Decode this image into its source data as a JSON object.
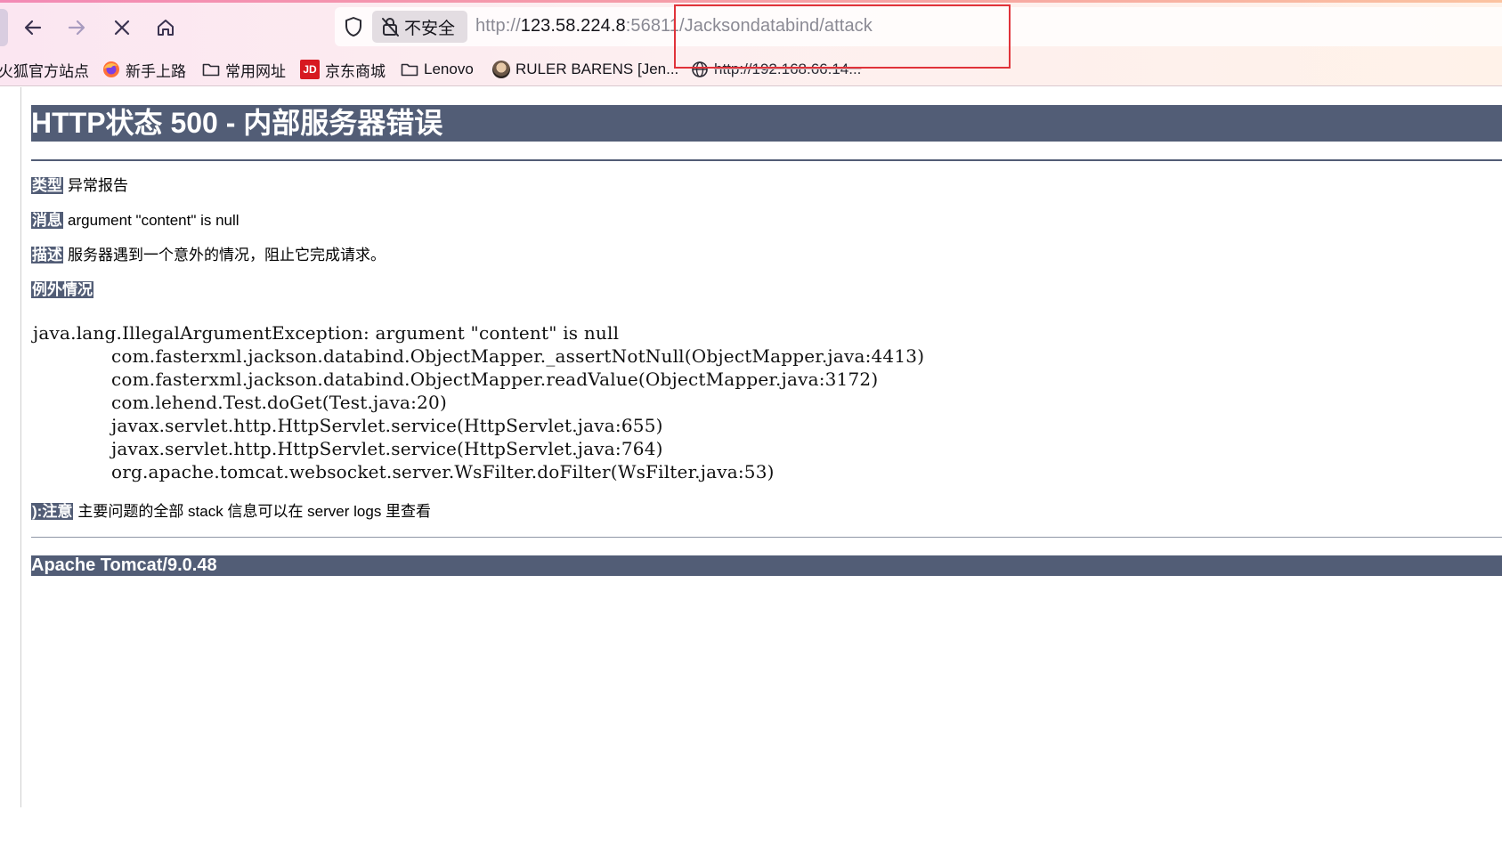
{
  "browser": {
    "nav": {
      "back_icon": "arrow-left-icon",
      "forward_icon": "arrow-right-icon",
      "stop_icon": "close-icon",
      "home_icon": "home-icon"
    },
    "urlbar": {
      "security_label": "不安全",
      "url_prefix": "http://",
      "url_host": "123.58.224.8",
      "url_rest": ":56811/Jacksondatabind/attack"
    },
    "bookmarks": [
      {
        "label": "火狐官方站点",
        "icon": "firefox-icon"
      },
      {
        "label": "新手上路",
        "icon": "firefox-icon"
      },
      {
        "label": "常用网址",
        "icon": "folder-icon"
      },
      {
        "label": "京东商城",
        "icon": "jd-logo-icon"
      },
      {
        "label": "Lenovo",
        "icon": "folder-icon"
      },
      {
        "label": "RULER BARENS [Jen...",
        "icon": "avatar-icon"
      },
      {
        "label": "http://192.168.66.14...",
        "icon": "globe-icon"
      }
    ],
    "accent_color": "#e0333a"
  },
  "page": {
    "title": "HTTP状态 500 - 内部服务器错误",
    "type_label": "类型",
    "type_value": "异常报告",
    "message_label": "消息",
    "message_value": "argument \"content\" is null",
    "description_label": "描述",
    "description_value": "服务器遇到一个意外的情况，阻止它完成请求。",
    "exception_label": "例外情况",
    "stack": {
      "exception": "java.lang.IllegalArgumentException: argument \"content\" is null",
      "frames": [
        "com.fasterxml.jackson.databind.ObjectMapper._assertNotNull(ObjectMapper.java:4413)",
        "com.fasterxml.jackson.databind.ObjectMapper.readValue(ObjectMapper.java:3172)",
        "com.lehend.Test.doGet(Test.java:20)",
        "javax.servlet.http.HttpServlet.service(HttpServlet.java:655)",
        "javax.servlet.http.HttpServlet.service(HttpServlet.java:764)",
        "org.apache.tomcat.websocket.server.WsFilter.doFilter(WsFilter.java:53)"
      ]
    },
    "note_label": "):注意",
    "note_value": "主要问题的全部 stack 信息可以在 server logs 里查看",
    "footer": "Apache Tomcat/9.0.48",
    "header_bg_color": "#525d76"
  }
}
